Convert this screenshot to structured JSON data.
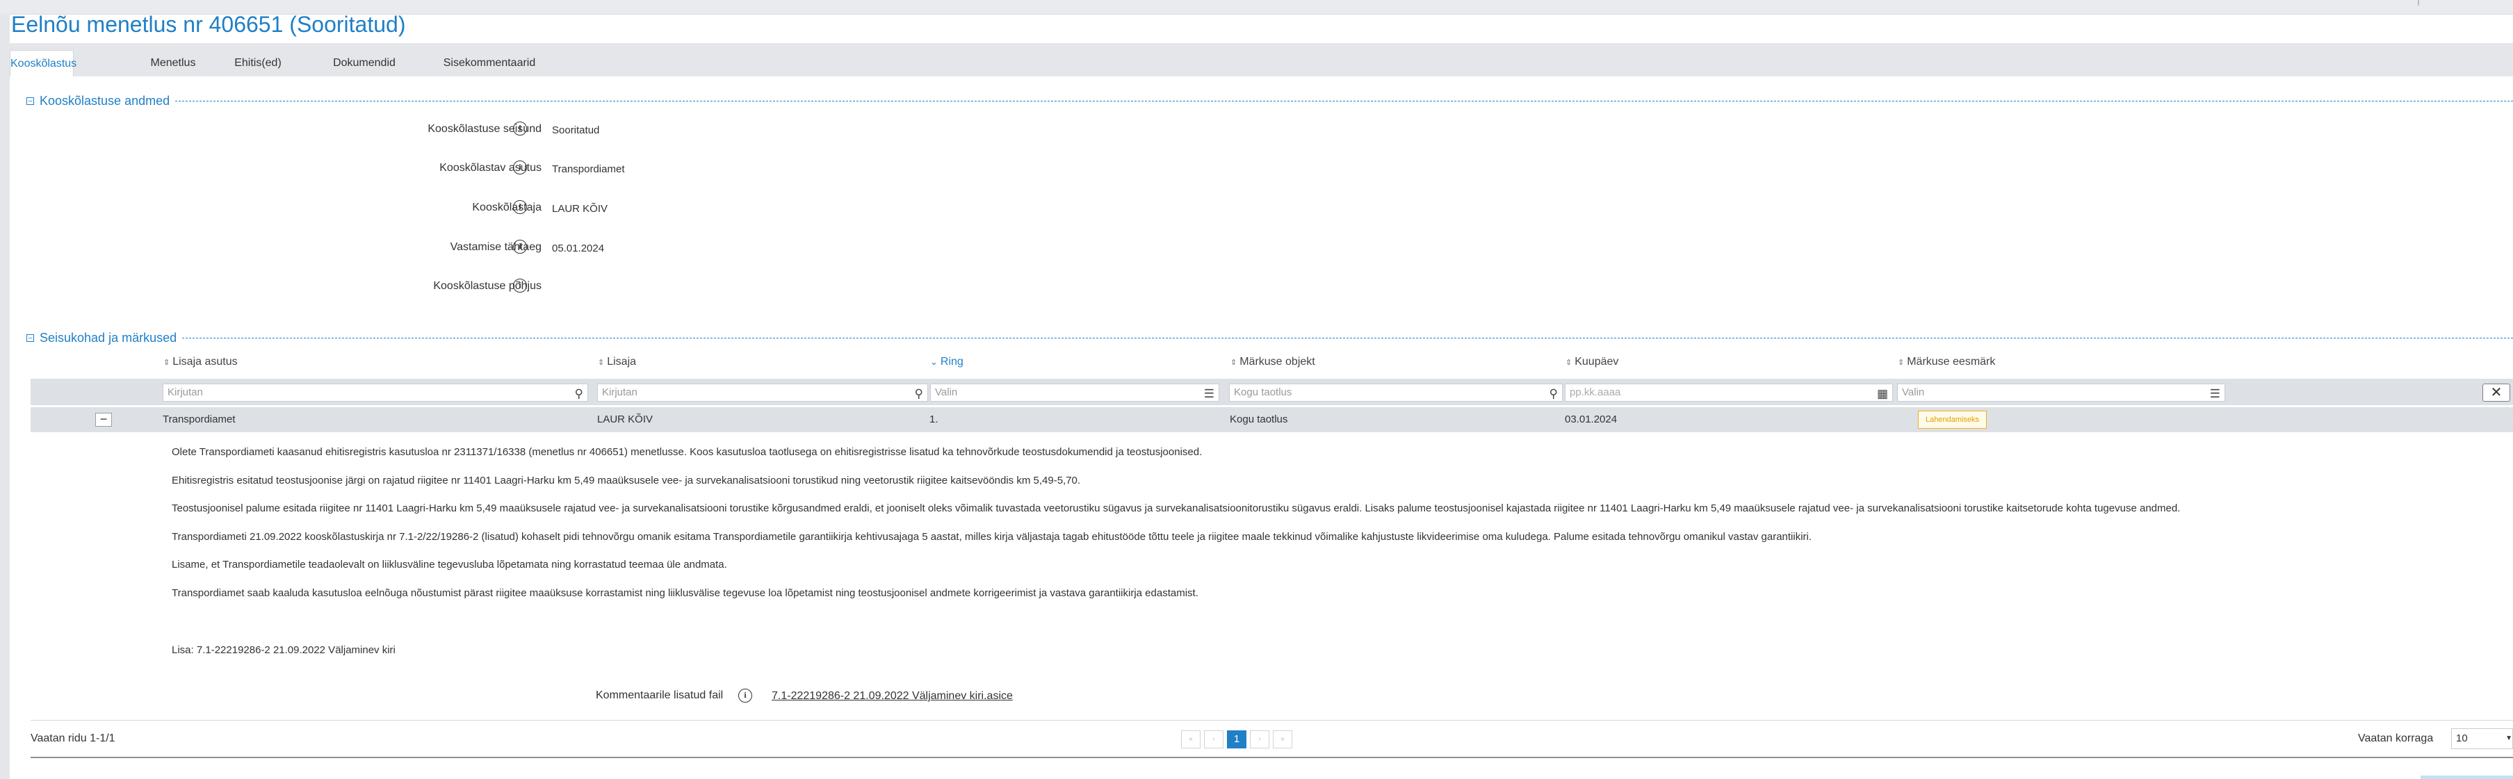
{
  "page_title": "Eelnõu menetlus nr 406651 (Sooritatud)",
  "tabs": [
    "Kooskõlastus",
    "Menetlus",
    "Ehitis(ed)",
    "Dokumendid",
    "Sisekommentaarid"
  ],
  "active_tab": "Kooskõlastus",
  "approval_section": {
    "title": "Kooskõlastuse andmed",
    "fields": [
      {
        "label": "Kooskõlastuse seisund",
        "value": "Sooritatud"
      },
      {
        "label": "Kooskõlastav asutus",
        "value": "Transpordiamet"
      },
      {
        "label": "Kooskõlastaja",
        "value": "LAUR KÕIV"
      },
      {
        "label": "Vastamise tähtaeg",
        "value": "05.01.2024"
      },
      {
        "label": "Kooskõlastuse põhjus",
        "value": ""
      }
    ]
  },
  "remarks_section": {
    "title": "Seisukohad ja märkused",
    "columns": [
      "Lisaja asutus",
      "Lisaja",
      "Ring",
      "Märkuse objekt",
      "Kuupäev",
      "Märkuse eesmärk"
    ],
    "sorted_column": "Ring",
    "filters": [
      {
        "placeholder": "Kirjutan",
        "icon": "search-icon"
      },
      {
        "placeholder": "Kirjutan",
        "icon": "search-icon"
      },
      {
        "placeholder": "Valin",
        "icon": "list-icon"
      },
      {
        "placeholder": "Kogu taotlus",
        "icon": "search-icon"
      },
      {
        "placeholder": "pp.kk.aaaa",
        "icon": "calendar-icon"
      },
      {
        "placeholder": "Valin",
        "icon": "list-icon"
      }
    ],
    "clear_filters_icon": "close-icon",
    "row": {
      "institution": "Transpordiamet",
      "author": "LAUR KÕIV",
      "round": "1.",
      "object": "Kogu taotlus",
      "date": "03.01.2024",
      "purpose": "Lahendamiseks"
    },
    "paragraphs": [
      "Olete Transpordiameti kaasanud ehitisregistris kasutusloa nr 2311371/16338 (menetlus nr 406651) menetlusse. Koos kasutusloa taotlusega on ehitisregistrisse lisatud ka tehnovõrkude teostusdokumendid ja teostusjoonised.",
      "Ehitisregistris esitatud teostusjoonise järgi on rajatud riigitee nr 11401 Laagri-Harku km 5,49 maaüksusele vee- ja survekanalisatsiooni torustikud ning veetorustik riigitee kaitsevööndis km 5,49-5,70.",
      "Teostusjoonisel palume esitada riigitee nr 11401 Laagri-Harku km 5,49 maaüksusele rajatud vee- ja survekanalisatsiooni torustike kõrgusandmed eraldi, et jooniselt oleks võimalik tuvastada veetorustiku sügavus ja survekanalisatsioonitorustiku sügavus eraldi. Lisaks palume teostusjoonisel kajastada riigitee nr 11401 Laagri-Harku km 5,49 maaüksusele rajatud vee- ja survekanalisatsiooni torustike kaitsetorude kohta tugevuse andmed.",
      "Transpordiameti 21.09.2022 kooskõlastuskirja nr 7.1-2/22/19286-2 (lisatud) kohaselt pidi tehnovõrgu omanik esitama Transpordiametile garantiikirja kehtivusajaga 5 aastat, milles kirja väljastaja tagab ehitustööde tõttu teele ja riigitee maale tekkinud võimalike kahjustuste likvideerimise oma kuludega. Palume esitada tehnovõrgu omanikul vastav garantiikiri.",
      "Lisame, et Transpordiametile teadaolevalt on liiklusväline tegevusluba lõpetamata ning korrastatud teemaa üle andmata.",
      "Transpordiamet saab kaaluda kasutusloa eelnõuga nõustumist pärast riigitee maaüksuse korrastamist ning liiklusvälise tegevuse loa lõpetamist ning teostusjoonisel andmete korrigeerimist ja vastava garantiikirja edastamist.",
      "Lisa: 7.1-22219286-2 21.09.2022 Väljaminev kiri"
    ],
    "attachment_label": "Kommentaarile lisatud fail",
    "attachment_file": "7.1-22219286-2 21.09.2022 Väljaminev kiri.asice"
  },
  "pagination": {
    "rows_info": "Vaatan ridu 1-1/1",
    "current_page": "1",
    "per_page_label": "Vaatan korraga",
    "per_page_value": "10"
  }
}
